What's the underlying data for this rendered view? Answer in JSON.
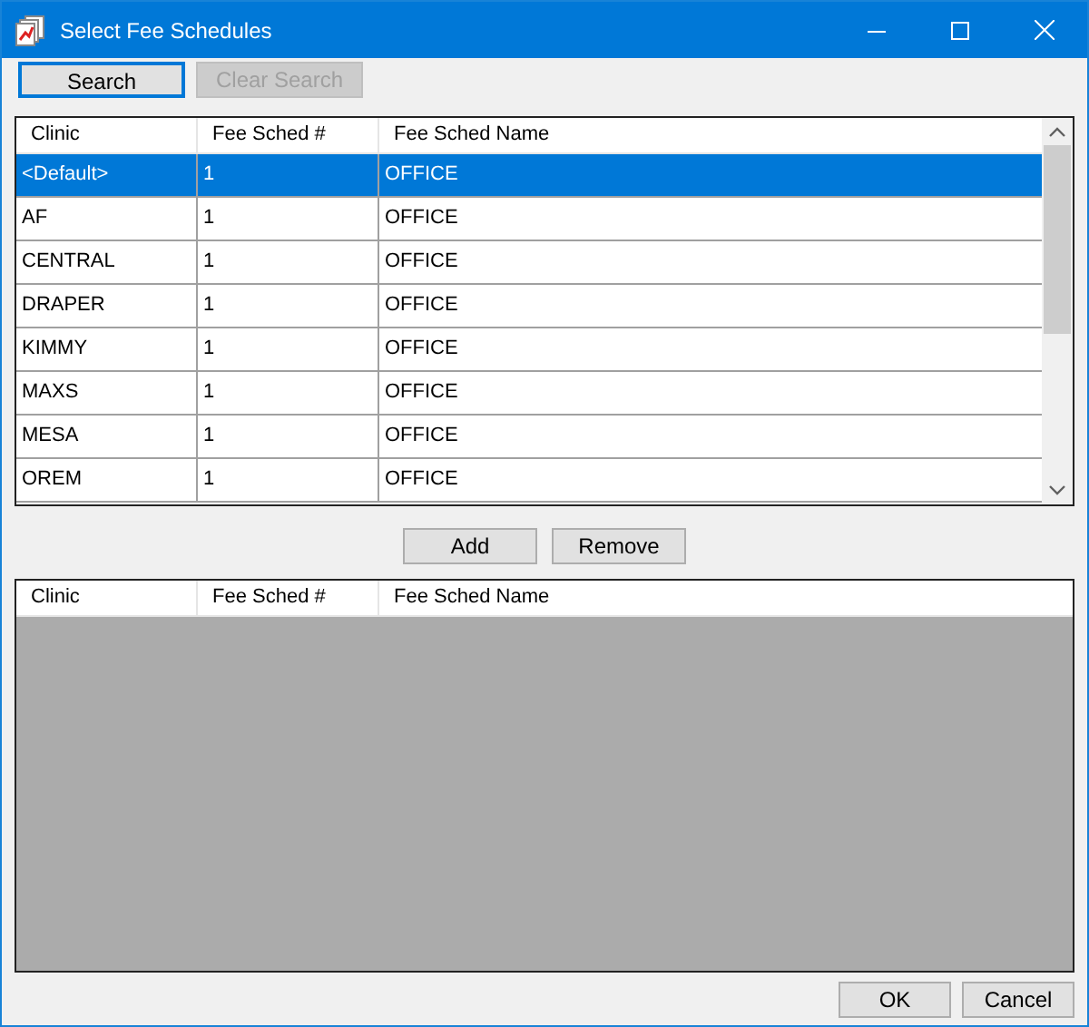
{
  "window": {
    "title": "Select Fee Schedules"
  },
  "toolbar": [
    {
      "label": "Search",
      "disabled": false,
      "focused": true
    },
    {
      "label": "Clear Search",
      "disabled": true,
      "focused": false
    }
  ],
  "available_grid": {
    "columns": [
      "Clinic",
      "Fee Sched #",
      "Fee Sched Name"
    ],
    "rows": [
      {
        "cells": [
          "<Default>",
          "1",
          "OFFICE"
        ],
        "selected": true
      },
      {
        "cells": [
          "AF",
          "1",
          "OFFICE"
        ],
        "selected": false
      },
      {
        "cells": [
          "CENTRAL",
          "1",
          "OFFICE"
        ],
        "selected": false
      },
      {
        "cells": [
          "DRAPER",
          "1",
          "OFFICE"
        ],
        "selected": false
      },
      {
        "cells": [
          "KIMMY",
          "1",
          "OFFICE"
        ],
        "selected": false
      },
      {
        "cells": [
          "MAXS",
          "1",
          "OFFICE"
        ],
        "selected": false
      },
      {
        "cells": [
          "MESA",
          "1",
          "OFFICE"
        ],
        "selected": false
      },
      {
        "cells": [
          "OREM",
          "1",
          "OFFICE"
        ],
        "selected": false
      }
    ]
  },
  "middle_buttons": [
    "Add",
    "Remove"
  ],
  "selected_grid": {
    "columns": [
      "Clinic",
      "Fee Sched #",
      "Fee Sched Name"
    ]
  },
  "footer_buttons": [
    "OK",
    "Cancel"
  ]
}
